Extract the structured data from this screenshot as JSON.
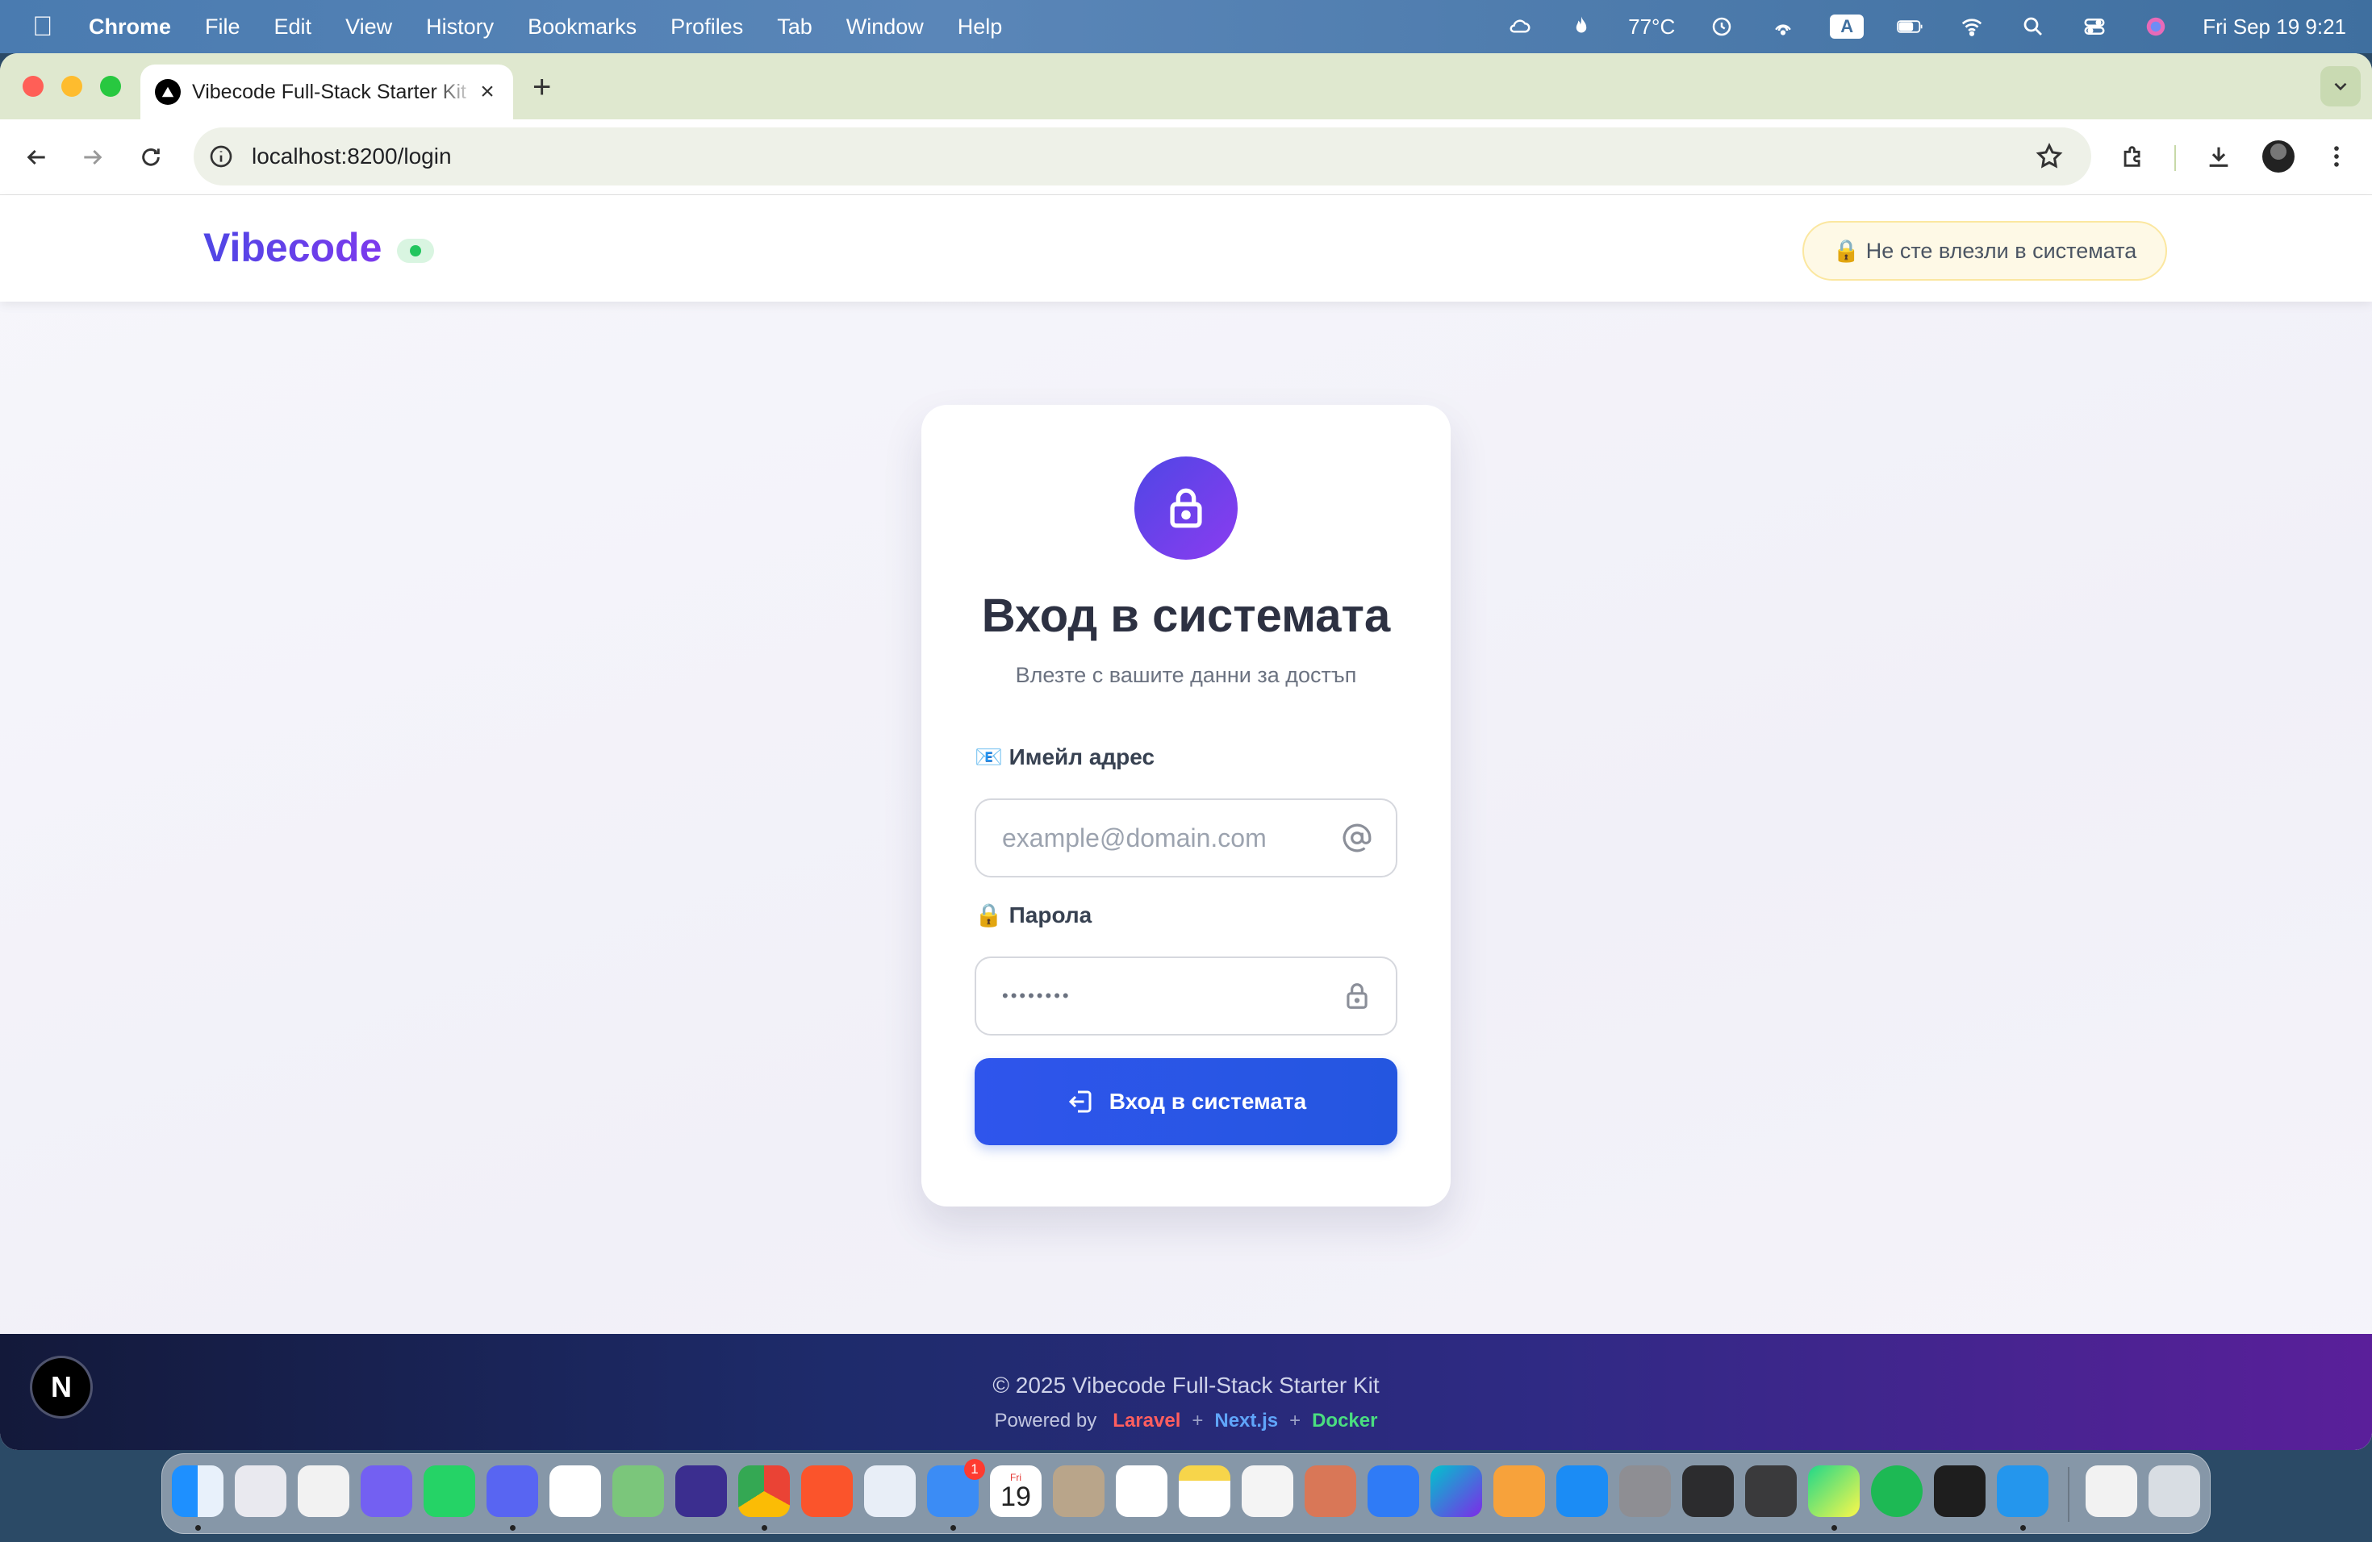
{
  "menubar": {
    "app": "Chrome",
    "items": [
      "File",
      "Edit",
      "View",
      "History",
      "Bookmarks",
      "Profiles",
      "Tab",
      "Window",
      "Help"
    ],
    "temperature": "77°C",
    "input_source": "A",
    "datetime": "Fri Sep 19  9:21"
  },
  "browser": {
    "tab_title": "Vibecode Full-Stack Starter Kit",
    "url": "localhost:8200/login"
  },
  "header": {
    "brand": "Vibecode",
    "auth_status": "🔒 Не сте влезли в системата"
  },
  "login": {
    "title": "Вход в системата",
    "subtitle": "Влезте с вашите данни за достъп",
    "email_label": "📧 Имейл адрес",
    "email_placeholder": "example@domain.com",
    "password_label": "🔒 Парола",
    "password_value": "••••••••",
    "submit_label": "Вход в системата"
  },
  "footer": {
    "copyright": "© 2025 Vibecode Full-Stack Starter Kit",
    "powered_by": "Powered by",
    "tech": [
      "Laravel",
      "Next.js",
      "Docker"
    ],
    "separator": "+"
  },
  "next_badge": "N",
  "dock": {
    "calendar_month": "Fri",
    "calendar_day": "19",
    "mail_badge": "1",
    "apps": [
      "finder-icon",
      "launchpad-icon",
      "scrivener-icon",
      "viber-icon",
      "whatsapp-icon",
      "discord-icon",
      "slack-icon",
      "maps-icon",
      "firefox-icon",
      "chrome-icon",
      "brave-icon",
      "drive-icon",
      "mail-icon",
      "calendar-icon",
      "contacts-icon",
      "reminders-icon",
      "notes-icon",
      "freeform-icon",
      "claude-icon",
      "keynote-icon",
      "canva-icon",
      "pages-icon",
      "app-store-icon",
      "system-settings-icon",
      "disk-utility-icon",
      "final-cut-icon",
      "pycharm-icon",
      "spotify-icon",
      "figma-icon",
      "docker-icon",
      "downloads-stack-icon",
      "trash-icon"
    ]
  },
  "colors": {
    "accent": "#4f46e5",
    "button": "#2456e0",
    "footer_start": "#13193a",
    "footer_end": "#5a1f9a"
  }
}
